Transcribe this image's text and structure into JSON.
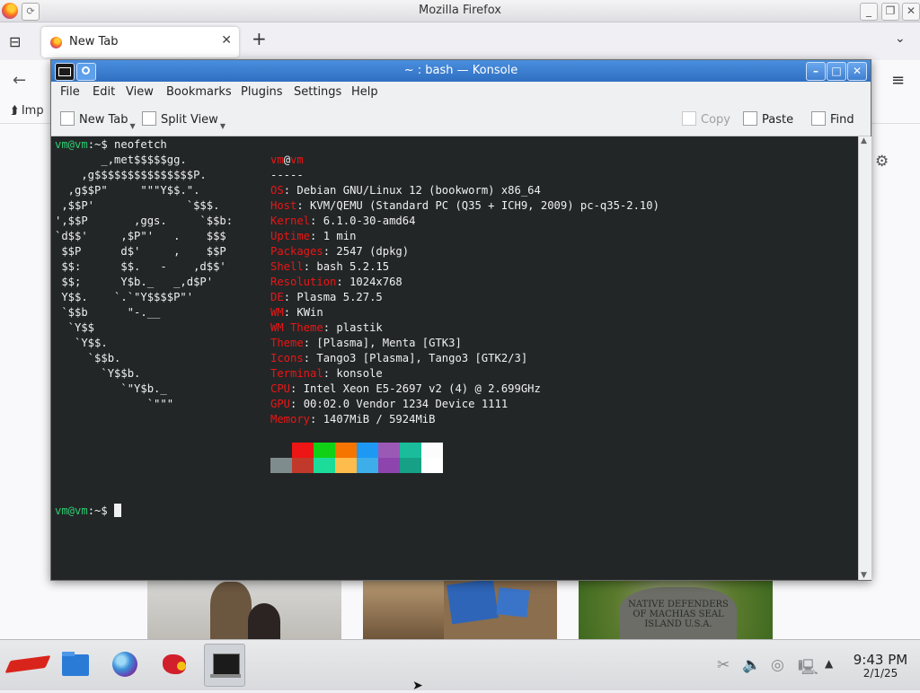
{
  "firefox": {
    "window_title": "Mozilla Firefox",
    "tab_label": "New Tab",
    "bookmarks_partial": "Imp",
    "photo3_text": "NATIVE DEFENDERS OF MACHIAS SEAL ISLAND U.S.A."
  },
  "konsole": {
    "title": "~ : bash — Konsole",
    "menu": [
      "File",
      "Edit",
      "View",
      "Bookmarks",
      "Plugins",
      "Settings",
      "Help"
    ],
    "toolbar": {
      "new_tab": "New Tab",
      "split_view": "Split View",
      "copy": "Copy",
      "paste": "Paste",
      "find": "Find"
    }
  },
  "terminal": {
    "prompt_user": "vm@vm",
    "prompt_path": ":~$",
    "command": " neofetch",
    "logo_lines": [
      "       _,met$$$$$gg.",
      "    ,g$$$$$$$$$$$$$$$P.",
      "  ,g$$P\"     \"\"\"Y$$.\".",
      " ,$$P'              `$$$.",
      "',$$P       ,ggs.     `$$b:",
      "`d$$'     ,$P\"'   .    $$$",
      " $$P      d$'     ,    $$P",
      " $$:      $$.   -    ,d$$'",
      " $$;      Y$b._   _,d$P'",
      " Y$$.    `.`\"Y$$$$P\"'",
      " `$$b      \"-.__",
      "  `Y$$",
      "   `Y$$.",
      "     `$$b.",
      "       `Y$$b.",
      "          `\"Y$b._",
      "              `\"\"\""
    ],
    "header_user": "vm",
    "header_at": "@",
    "header_host": "vm",
    "separator": "-----",
    "info": [
      {
        "key": "OS",
        "value": "Debian GNU/Linux 12 (bookworm) x86_64"
      },
      {
        "key": "Host",
        "value": "KVM/QEMU (Standard PC (Q35 + ICH9, 2009) pc-q35-2.10)"
      },
      {
        "key": "Kernel",
        "value": "6.1.0-30-amd64"
      },
      {
        "key": "Uptime",
        "value": "1 min"
      },
      {
        "key": "Packages",
        "value": "2547 (dpkg)"
      },
      {
        "key": "Shell",
        "value": "bash 5.2.15"
      },
      {
        "key": "Resolution",
        "value": "1024x768"
      },
      {
        "key": "DE",
        "value": "Plasma 5.27.5"
      },
      {
        "key": "WM",
        "value": "KWin"
      },
      {
        "key": "WM Theme",
        "value": "plastik"
      },
      {
        "key": "Theme",
        "value": "[Plasma], Menta [GTK3]"
      },
      {
        "key": "Icons",
        "value": "Tango3 [Plasma], Tango3 [GTK2/3]"
      },
      {
        "key": "Terminal",
        "value": "konsole"
      },
      {
        "key": "CPU",
        "value": "Intel Xeon E5-2697 v2 (4) @ 2.699GHz"
      },
      {
        "key": "GPU",
        "value": "00:02.0 Vendor 1234 Device 1111"
      },
      {
        "key": "Memory",
        "value": "1407MiB / 5924MiB"
      }
    ],
    "palette_dark": [
      "#232627",
      "#ed1515",
      "#11d116",
      "#f67400",
      "#1d99f3",
      "#9b59b6",
      "#1abc9c",
      "#fcfcfc"
    ],
    "palette_bright": [
      "#7f8c8d",
      "#c0392b",
      "#1cdc9a",
      "#fdbc4b",
      "#3daee9",
      "#8e44ad",
      "#16a085",
      "#ffffff"
    ]
  },
  "taskbar": {
    "clock_time": "9:43 PM",
    "clock_date": "2/1/25"
  },
  "colors": {
    "konsole_title_blue": "#3a7fd5",
    "terminal_bg": "#232627",
    "prompt_green": "#2ecc71",
    "neofetch_red": "#ed1515"
  }
}
